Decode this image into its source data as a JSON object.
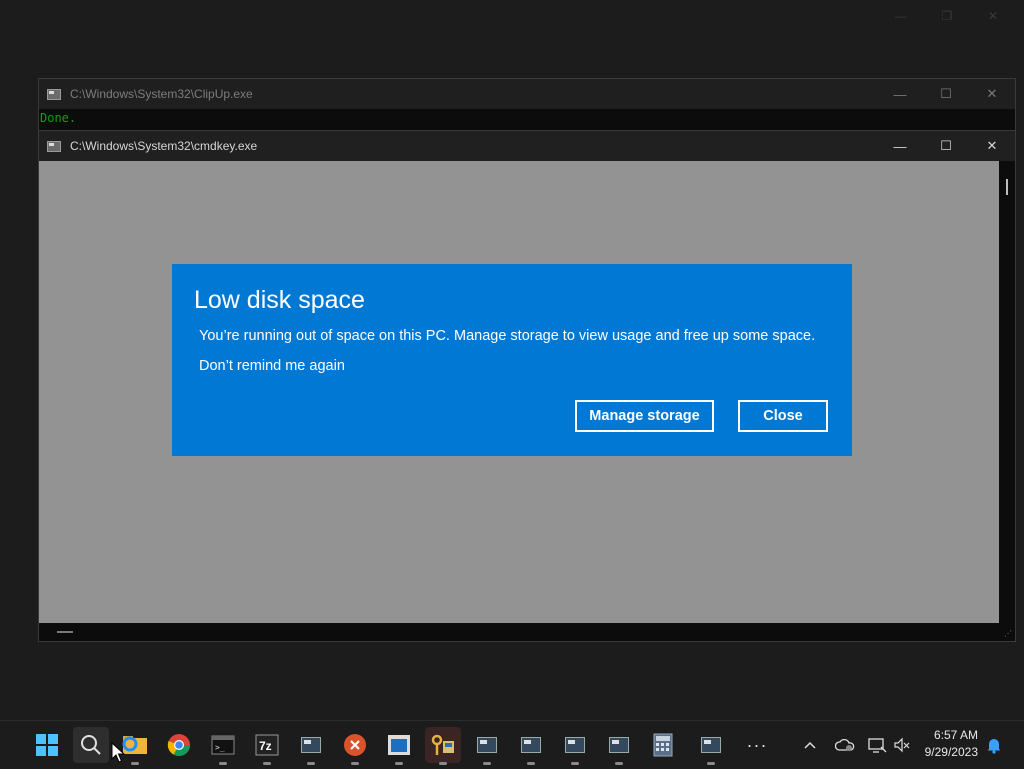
{
  "windows": {
    "clipup": {
      "title": "C:\\Windows\\System32\\ClipUp.exe",
      "output": "Done."
    },
    "cmdkey": {
      "title": "C:\\Windows\\System32\\cmdkey.exe"
    }
  },
  "window_controls": {
    "minimize": "—",
    "maximize": "☐",
    "close": "✕"
  },
  "toast": {
    "title": "Low disk space",
    "message": "You’re running out of space on this PC. Manage storage to view usage and free up some space.",
    "dont_remind": "Don’t remind me again",
    "manage_label": "Manage storage",
    "close_label": "Close",
    "bg_color": "#0078d4"
  },
  "taskbar": {
    "items": [
      {
        "icon": "windows-start-icon"
      },
      {
        "icon": "search-icon"
      },
      {
        "icon": "file-explorer-icon"
      },
      {
        "icon": "chrome-icon"
      },
      {
        "icon": "terminal-icon"
      },
      {
        "icon": "7zip-icon",
        "label": "7z"
      },
      {
        "icon": "cmd-window-icon"
      },
      {
        "icon": "error-app-icon"
      },
      {
        "icon": "app-window-icon"
      },
      {
        "icon": "keys-icon"
      },
      {
        "icon": "cmd-window-icon"
      },
      {
        "icon": "cmd-window-icon"
      },
      {
        "icon": "cmd-window-icon"
      },
      {
        "icon": "cmd-window-icon"
      },
      {
        "icon": "calculator-icon"
      },
      {
        "icon": "cmd-window-icon"
      },
      {
        "icon": "more-icon"
      }
    ],
    "clock": {
      "time": "6:57 AM",
      "date": "9/29/2023"
    }
  }
}
